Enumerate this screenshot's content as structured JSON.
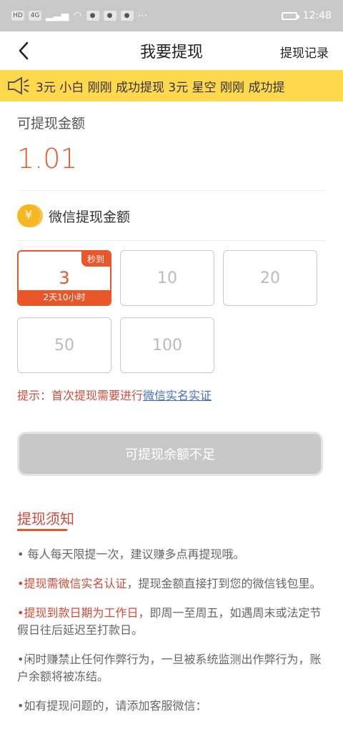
{
  "statusbar": {
    "time": "12:48",
    "left_chips": [
      "HD",
      "4G",
      "⋯"
    ]
  },
  "header": {
    "title": "我要提现",
    "record": "提现记录"
  },
  "marquee": {
    "text": "3元    小白 刚刚 成功提现 3元    星空 刚刚 成功提"
  },
  "amount_section": {
    "label": "可提现金额",
    "value": "1.01"
  },
  "wechat": {
    "coin_symbol": "¥",
    "label": "微信提现金额"
  },
  "options": [
    {
      "value": "3",
      "badge": "秒到",
      "footer": "2天10小时"
    },
    {
      "value": "10"
    },
    {
      "value": "20"
    },
    {
      "value": "50"
    },
    {
      "value": "100"
    }
  ],
  "tip": {
    "prefix": "提示：首次提现需要进行",
    "link": "微信实名实证"
  },
  "action": {
    "label": "可提现余额不足"
  },
  "notice": {
    "title": "提现须知",
    "rules": [
      {
        "red": "",
        "text": "• 每人每天限提一次，建议赚多点再提现哦。"
      },
      {
        "red": "•提现需微信实名认证",
        "text": "，提现金额直接打到您的微信钱包里。"
      },
      {
        "red": "•提现到款日期为工作日",
        "text": "，即周一至周五，如遇周末或法定节假日往后延迟至打款日。"
      },
      {
        "red": "",
        "text": "•闲时赚禁止任何作弊行为，一旦被系统监测出作弊行为，账户余额将被冻结。"
      },
      {
        "red": "",
        "text": "•如有提现问题的，请添加客服微信："
      }
    ]
  },
  "colors": {
    "accent": "#e8562a",
    "marquee_bg": "#ffd84d",
    "status_bg": "#c9c9c9"
  }
}
